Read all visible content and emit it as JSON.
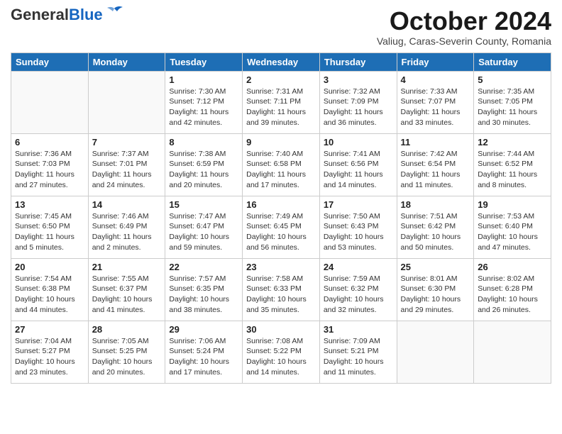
{
  "header": {
    "logo_general": "General",
    "logo_blue": "Blue",
    "month_title": "October 2024",
    "subtitle": "Valiug, Caras-Severin County, Romania"
  },
  "weekdays": [
    "Sunday",
    "Monday",
    "Tuesday",
    "Wednesday",
    "Thursday",
    "Friday",
    "Saturday"
  ],
  "weeks": [
    [
      {
        "day": "",
        "info": ""
      },
      {
        "day": "",
        "info": ""
      },
      {
        "day": "1",
        "info": "Sunrise: 7:30 AM\nSunset: 7:12 PM\nDaylight: 11 hours and 42 minutes."
      },
      {
        "day": "2",
        "info": "Sunrise: 7:31 AM\nSunset: 7:11 PM\nDaylight: 11 hours and 39 minutes."
      },
      {
        "day": "3",
        "info": "Sunrise: 7:32 AM\nSunset: 7:09 PM\nDaylight: 11 hours and 36 minutes."
      },
      {
        "day": "4",
        "info": "Sunrise: 7:33 AM\nSunset: 7:07 PM\nDaylight: 11 hours and 33 minutes."
      },
      {
        "day": "5",
        "info": "Sunrise: 7:35 AM\nSunset: 7:05 PM\nDaylight: 11 hours and 30 minutes."
      }
    ],
    [
      {
        "day": "6",
        "info": "Sunrise: 7:36 AM\nSunset: 7:03 PM\nDaylight: 11 hours and 27 minutes."
      },
      {
        "day": "7",
        "info": "Sunrise: 7:37 AM\nSunset: 7:01 PM\nDaylight: 11 hours and 24 minutes."
      },
      {
        "day": "8",
        "info": "Sunrise: 7:38 AM\nSunset: 6:59 PM\nDaylight: 11 hours and 20 minutes."
      },
      {
        "day": "9",
        "info": "Sunrise: 7:40 AM\nSunset: 6:58 PM\nDaylight: 11 hours and 17 minutes."
      },
      {
        "day": "10",
        "info": "Sunrise: 7:41 AM\nSunset: 6:56 PM\nDaylight: 11 hours and 14 minutes."
      },
      {
        "day": "11",
        "info": "Sunrise: 7:42 AM\nSunset: 6:54 PM\nDaylight: 11 hours and 11 minutes."
      },
      {
        "day": "12",
        "info": "Sunrise: 7:44 AM\nSunset: 6:52 PM\nDaylight: 11 hours and 8 minutes."
      }
    ],
    [
      {
        "day": "13",
        "info": "Sunrise: 7:45 AM\nSunset: 6:50 PM\nDaylight: 11 hours and 5 minutes."
      },
      {
        "day": "14",
        "info": "Sunrise: 7:46 AM\nSunset: 6:49 PM\nDaylight: 11 hours and 2 minutes."
      },
      {
        "day": "15",
        "info": "Sunrise: 7:47 AM\nSunset: 6:47 PM\nDaylight: 10 hours and 59 minutes."
      },
      {
        "day": "16",
        "info": "Sunrise: 7:49 AM\nSunset: 6:45 PM\nDaylight: 10 hours and 56 minutes."
      },
      {
        "day": "17",
        "info": "Sunrise: 7:50 AM\nSunset: 6:43 PM\nDaylight: 10 hours and 53 minutes."
      },
      {
        "day": "18",
        "info": "Sunrise: 7:51 AM\nSunset: 6:42 PM\nDaylight: 10 hours and 50 minutes."
      },
      {
        "day": "19",
        "info": "Sunrise: 7:53 AM\nSunset: 6:40 PM\nDaylight: 10 hours and 47 minutes."
      }
    ],
    [
      {
        "day": "20",
        "info": "Sunrise: 7:54 AM\nSunset: 6:38 PM\nDaylight: 10 hours and 44 minutes."
      },
      {
        "day": "21",
        "info": "Sunrise: 7:55 AM\nSunset: 6:37 PM\nDaylight: 10 hours and 41 minutes."
      },
      {
        "day": "22",
        "info": "Sunrise: 7:57 AM\nSunset: 6:35 PM\nDaylight: 10 hours and 38 minutes."
      },
      {
        "day": "23",
        "info": "Sunrise: 7:58 AM\nSunset: 6:33 PM\nDaylight: 10 hours and 35 minutes."
      },
      {
        "day": "24",
        "info": "Sunrise: 7:59 AM\nSunset: 6:32 PM\nDaylight: 10 hours and 32 minutes."
      },
      {
        "day": "25",
        "info": "Sunrise: 8:01 AM\nSunset: 6:30 PM\nDaylight: 10 hours and 29 minutes."
      },
      {
        "day": "26",
        "info": "Sunrise: 8:02 AM\nSunset: 6:28 PM\nDaylight: 10 hours and 26 minutes."
      }
    ],
    [
      {
        "day": "27",
        "info": "Sunrise: 7:04 AM\nSunset: 5:27 PM\nDaylight: 10 hours and 23 minutes."
      },
      {
        "day": "28",
        "info": "Sunrise: 7:05 AM\nSunset: 5:25 PM\nDaylight: 10 hours and 20 minutes."
      },
      {
        "day": "29",
        "info": "Sunrise: 7:06 AM\nSunset: 5:24 PM\nDaylight: 10 hours and 17 minutes."
      },
      {
        "day": "30",
        "info": "Sunrise: 7:08 AM\nSunset: 5:22 PM\nDaylight: 10 hours and 14 minutes."
      },
      {
        "day": "31",
        "info": "Sunrise: 7:09 AM\nSunset: 5:21 PM\nDaylight: 10 hours and 11 minutes."
      },
      {
        "day": "",
        "info": ""
      },
      {
        "day": "",
        "info": ""
      }
    ]
  ]
}
